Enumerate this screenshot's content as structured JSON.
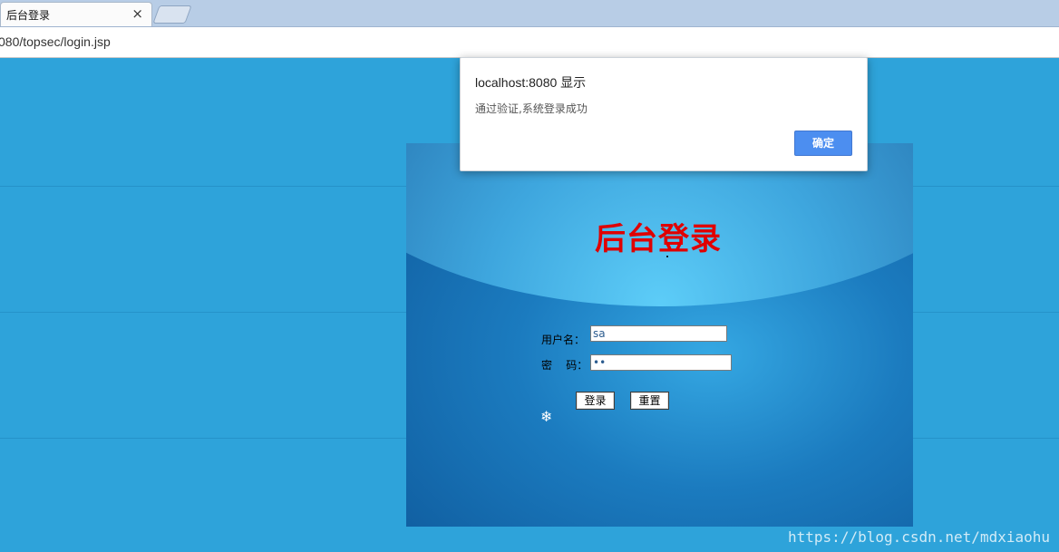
{
  "browser": {
    "tab_title": "后台登录",
    "close_glyph": "×",
    "url": "080/topsec/login.jsp"
  },
  "login": {
    "title": "后台登录",
    "username_label": "用户名：",
    "username_value": "sa",
    "password_label": "密    码：",
    "password_value": "••",
    "login_button": "登录",
    "reset_button": "重置",
    "spark_glyph": "❄"
  },
  "dialog": {
    "title": "localhost:8080 显示",
    "message": "通过验证,系统登录成功",
    "ok_button": "确定"
  },
  "watermark": "https://blog.csdn.net/mdxiaohu",
  "colors": {
    "accent": "#4c8ef0",
    "title_red": "#e00000",
    "page_blue": "#2ea3da"
  }
}
